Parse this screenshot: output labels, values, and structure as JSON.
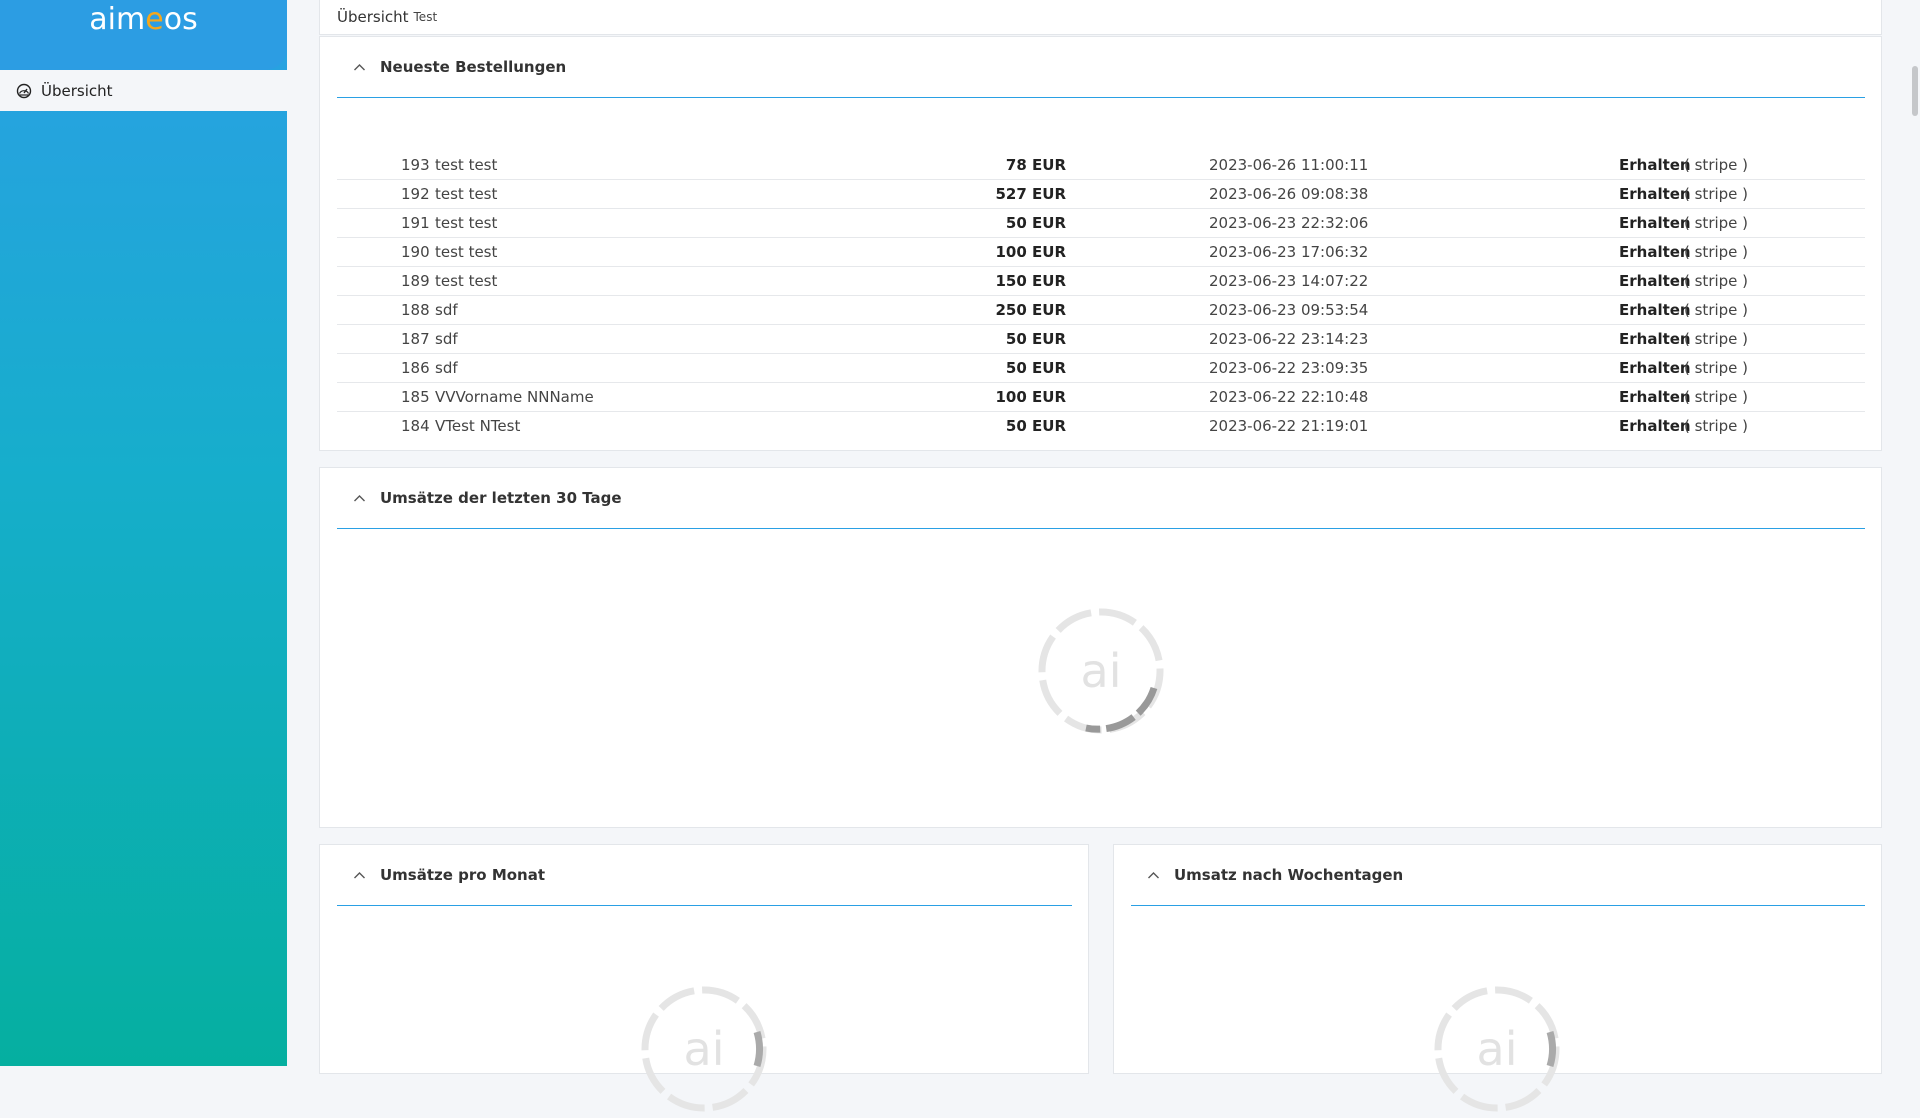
{
  "app": {
    "logo_left": "aim",
    "logo_accent": "e",
    "logo_right": "os",
    "brand_colors": {
      "primary": "#2c9de3",
      "accent": "#f4a71c",
      "teal": "#05afa0"
    }
  },
  "sidebar": {
    "items": [
      {
        "label": "Übersicht",
        "icon": "dashboard-gauge-icon"
      }
    ]
  },
  "header": {
    "title": "Übersicht",
    "subtitle": "Test"
  },
  "orders_panel": {
    "title": "Neueste Bestellungen",
    "rows": [
      {
        "id": "193",
        "name": "test test",
        "price": "78 EUR",
        "date": "2023-06-26 11:00:11",
        "status": "Erhalten",
        "payment": "( stripe )"
      },
      {
        "id": "192",
        "name": "test test",
        "price": "527 EUR",
        "date": "2023-06-26 09:08:38",
        "status": "Erhalten",
        "payment": "( stripe )"
      },
      {
        "id": "191",
        "name": "test test",
        "price": "50 EUR",
        "date": "2023-06-23 22:32:06",
        "status": "Erhalten",
        "payment": "( stripe )"
      },
      {
        "id": "190",
        "name": "test test",
        "price": "100 EUR",
        "date": "2023-06-23 17:06:32",
        "status": "Erhalten",
        "payment": "( stripe )"
      },
      {
        "id": "189",
        "name": "test test",
        "price": "150 EUR",
        "date": "2023-06-23 14:07:22",
        "status": "Erhalten",
        "payment": "( stripe )"
      },
      {
        "id": "188",
        "name": "sdf",
        "price": "250 EUR",
        "date": "2023-06-23 09:53:54",
        "status": "Erhalten",
        "payment": "( stripe )"
      },
      {
        "id": "187",
        "name": "sdf",
        "price": "50 EUR",
        "date": "2023-06-22 23:14:23",
        "status": "Erhalten",
        "payment": "( stripe )"
      },
      {
        "id": "186",
        "name": "sdf",
        "price": "50 EUR",
        "date": "2023-06-22 23:09:35",
        "status": "Erhalten",
        "payment": "( stripe )"
      },
      {
        "id": "185",
        "name": "VVVorname NNName",
        "price": "100 EUR",
        "date": "2023-06-22 22:10:48",
        "status": "Erhalten",
        "payment": "( stripe )"
      },
      {
        "id": "184",
        "name": "VTest NTest",
        "price": "50 EUR",
        "date": "2023-06-22 21:19:01",
        "status": "Erhalten",
        "payment": "( stripe )"
      }
    ]
  },
  "sales_30_days": {
    "title": "Umsätze der letzten 30 Tage",
    "loader_text": "ai"
  },
  "sales_per_month": {
    "title": "Umsätze pro Monat",
    "loader_text": "ai"
  },
  "sales_by_weekday": {
    "title": "Umsatz nach Wochentagen",
    "loader_text": "ai"
  }
}
